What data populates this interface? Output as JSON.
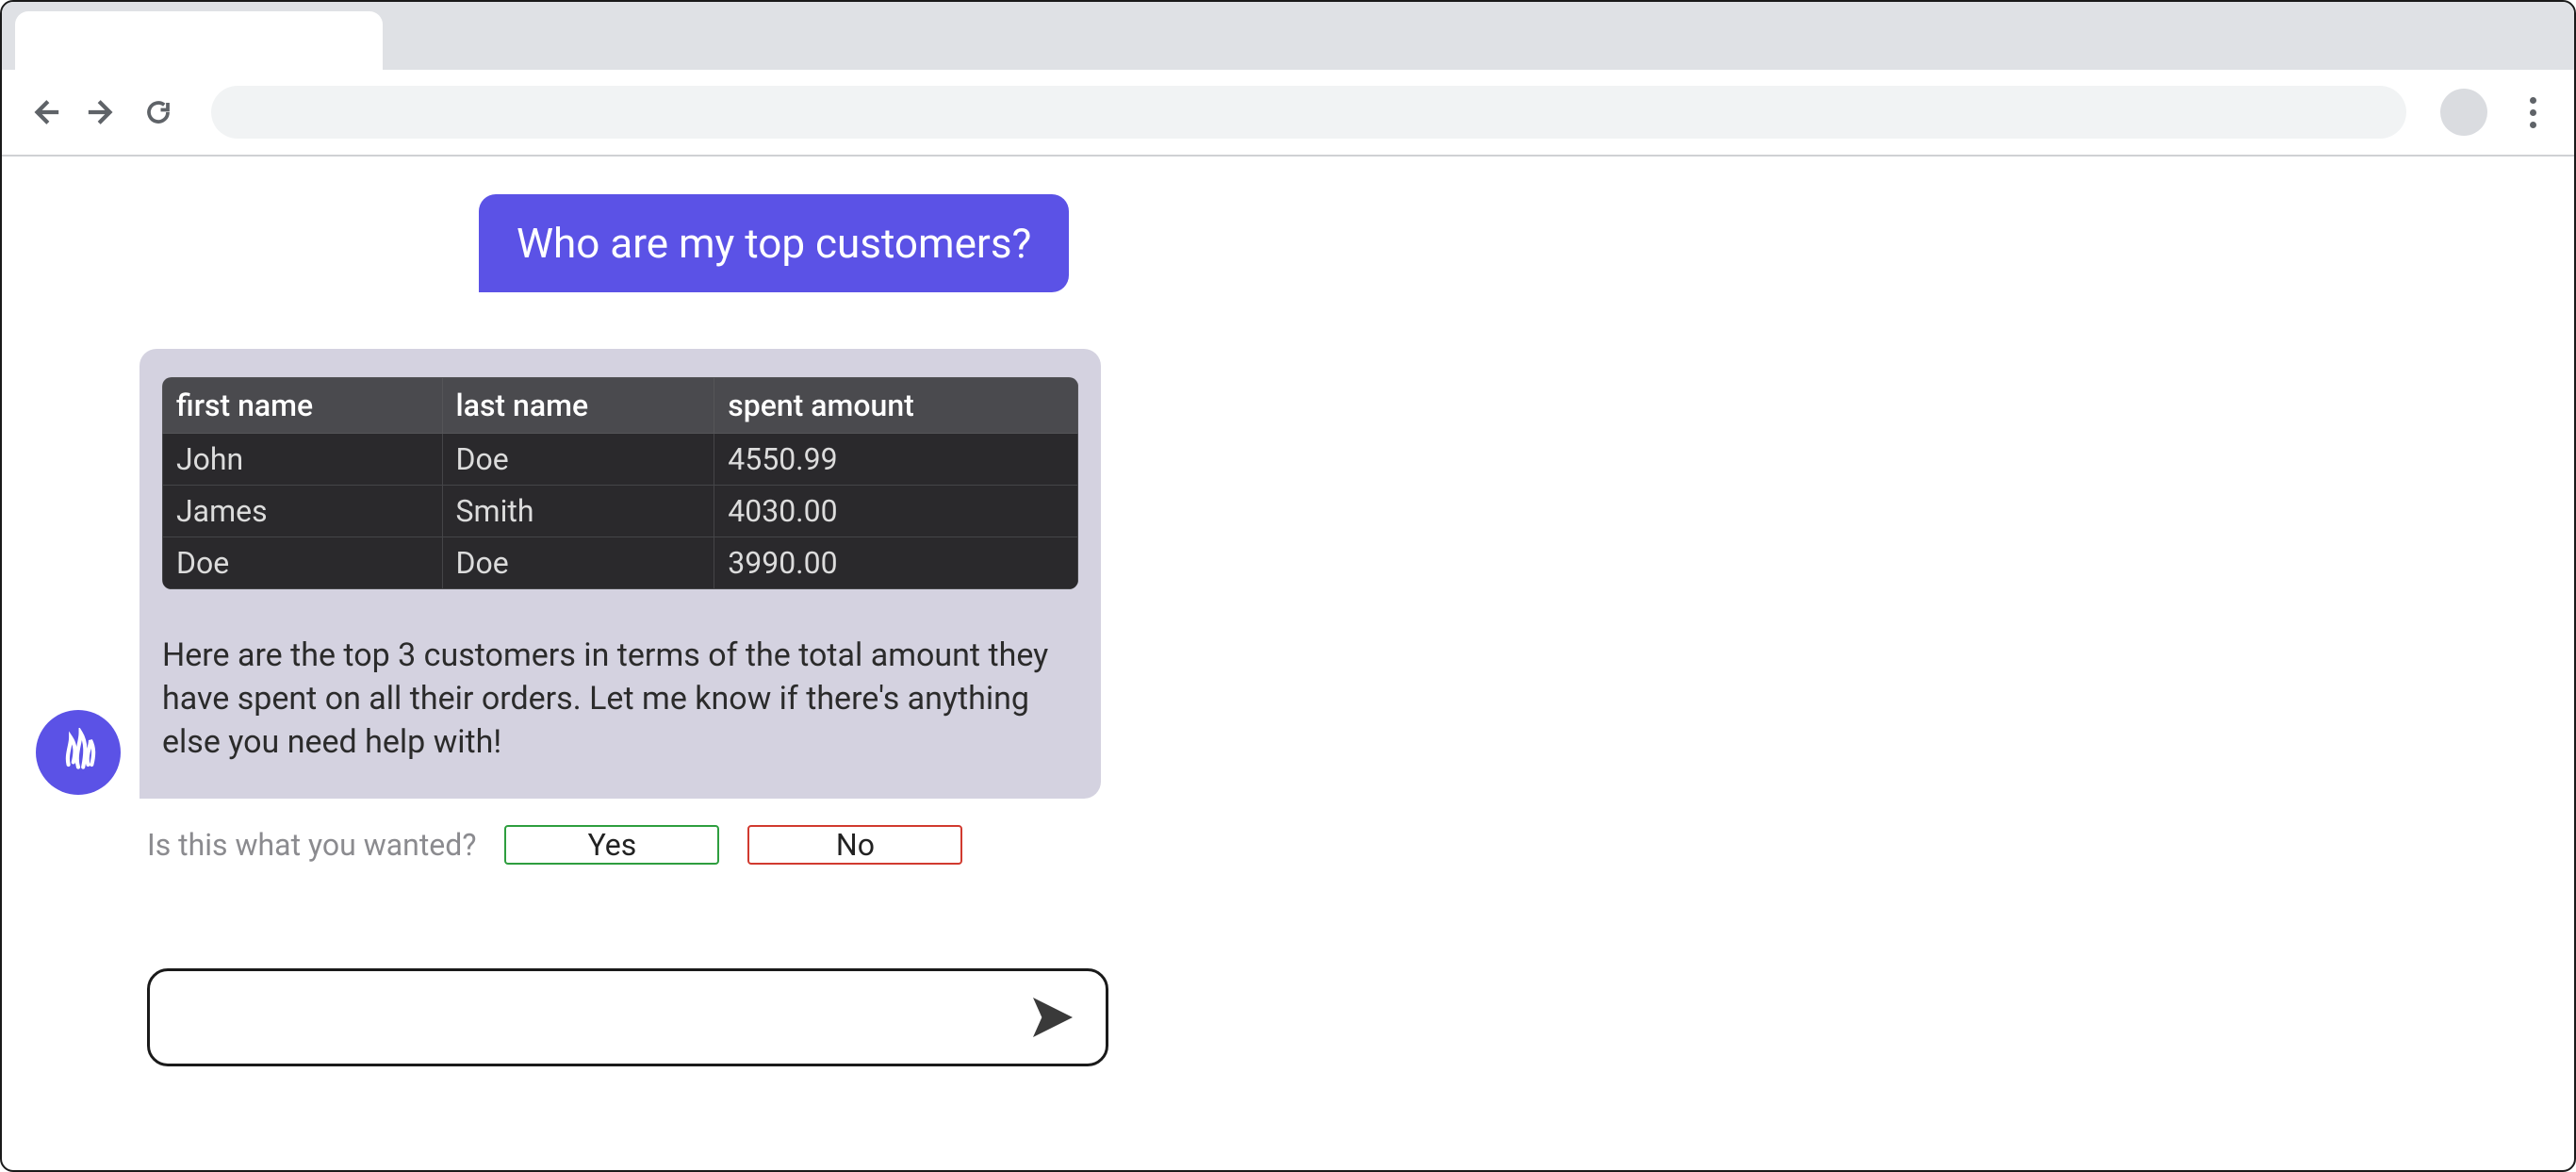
{
  "chat": {
    "user_message": "Who are my top customers?",
    "assistant_text": "Here are the top 3 customers in terms of the total amount they have spent on all their orders. Let me know if there's anything else you need help with!",
    "table": {
      "headers": [
        "first name",
        "last name",
        "spent amount"
      ],
      "rows": [
        {
          "first_name": "John",
          "last_name": "Doe",
          "spent_amount": "4550.99"
        },
        {
          "first_name": "James",
          "last_name": "Smith",
          "spent_amount": "4030.00"
        },
        {
          "first_name": "Doe",
          "last_name": "Doe",
          "spent_amount": "3990.00"
        }
      ]
    }
  },
  "feedback": {
    "prompt": "Is this what you wanted?",
    "yes": "Yes",
    "no": "No"
  },
  "composer": {
    "placeholder": ""
  }
}
